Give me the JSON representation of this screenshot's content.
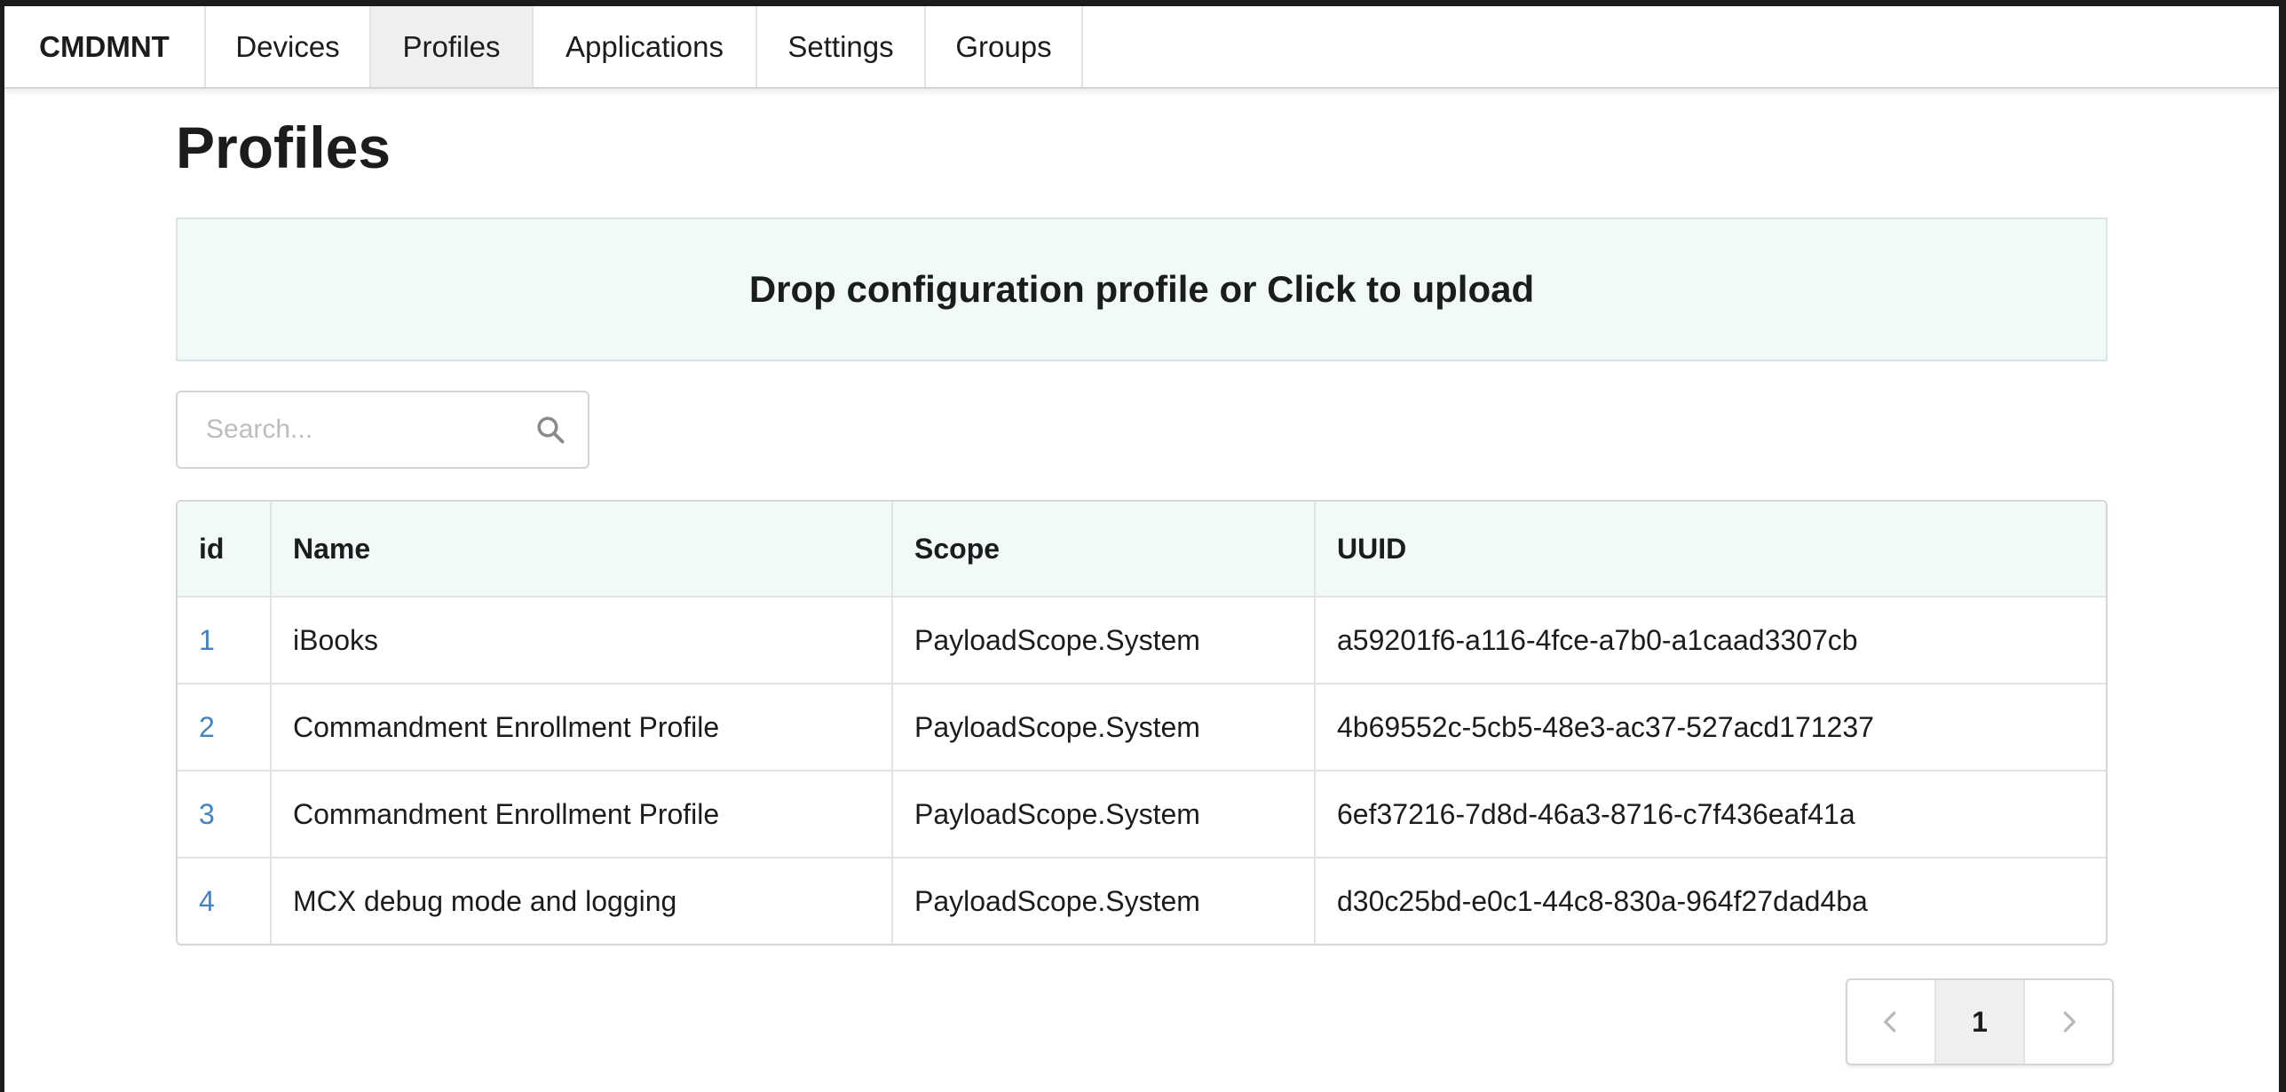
{
  "nav": {
    "brand": "CMDMNT",
    "items": [
      {
        "label": "Devices"
      },
      {
        "label": "Profiles",
        "active": true
      },
      {
        "label": "Applications"
      },
      {
        "label": "Settings"
      },
      {
        "label": "Groups"
      }
    ]
  },
  "page": {
    "title": "Profiles"
  },
  "dropzone": {
    "label": "Drop configuration profile or Click to upload"
  },
  "search": {
    "placeholder": "Search...",
    "value": "",
    "icon": "search-icon"
  },
  "table": {
    "columns": [
      "id",
      "Name",
      "Scope",
      "UUID"
    ],
    "rows": [
      {
        "id": "1",
        "name": "iBooks",
        "scope": "PayloadScope.System",
        "uuid": "a59201f6-a116-4fce-a7b0-a1caad3307cb"
      },
      {
        "id": "2",
        "name": "Commandment Enrollment Profile",
        "scope": "PayloadScope.System",
        "uuid": "4b69552c-5cb5-48e3-ac37-527acd171237"
      },
      {
        "id": "3",
        "name": "Commandment Enrollment Profile",
        "scope": "PayloadScope.System",
        "uuid": "6ef37216-7d8d-46a3-8716-c7f436eaf41a"
      },
      {
        "id": "4",
        "name": "MCX debug mode and logging",
        "scope": "PayloadScope.System",
        "uuid": "d30c25bd-e0c1-44c8-830a-964f27dad4ba"
      }
    ]
  },
  "pagination": {
    "prev_icon": "chevron-left-icon",
    "current_page": "1",
    "next_icon": "chevron-right-icon"
  },
  "colors": {
    "link": "#4183c4",
    "header_bg": "#f1faf9",
    "active_menu_bg": "#efefef"
  }
}
